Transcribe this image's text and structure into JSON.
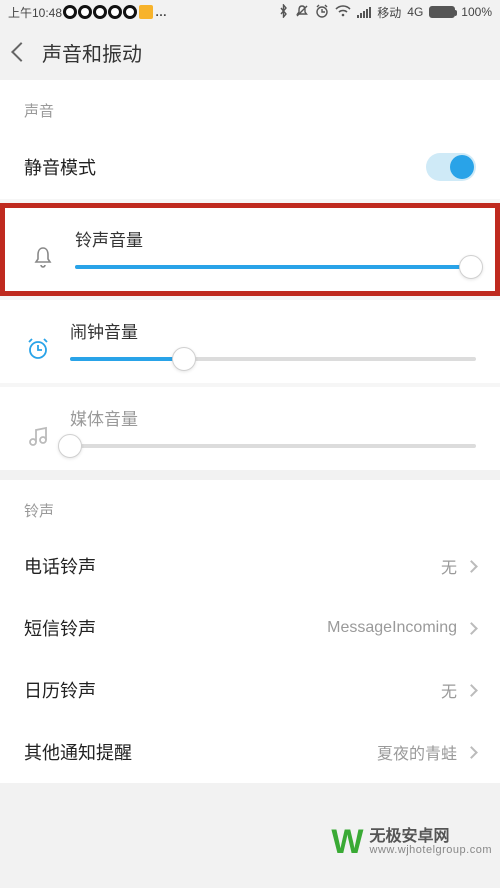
{
  "statusbar": {
    "time": "上午10:48",
    "carrier": "移动",
    "network": "4G",
    "battery": "100%"
  },
  "header": {
    "title": "声音和振动"
  },
  "section_sound": {
    "label": "声音",
    "silent_mode_label": "静音模式",
    "silent_mode_on": true
  },
  "sliders": {
    "ring": {
      "label": "铃声音量",
      "value": 100
    },
    "alarm": {
      "label": "闹钟音量",
      "value": 28
    },
    "media": {
      "label": "媒体音量",
      "value": 0
    }
  },
  "section_ringtone": {
    "label": "铃声",
    "items": [
      {
        "label": "电话铃声",
        "value": "无"
      },
      {
        "label": "短信铃声",
        "value": "MessageIncoming"
      },
      {
        "label": "日历铃声",
        "value": "无"
      },
      {
        "label": "其他通知提醒",
        "value": "夏夜的青蛙"
      }
    ]
  },
  "watermark": {
    "line1": "无极安卓网",
    "line2": "www.wjhotelgroup.com"
  }
}
